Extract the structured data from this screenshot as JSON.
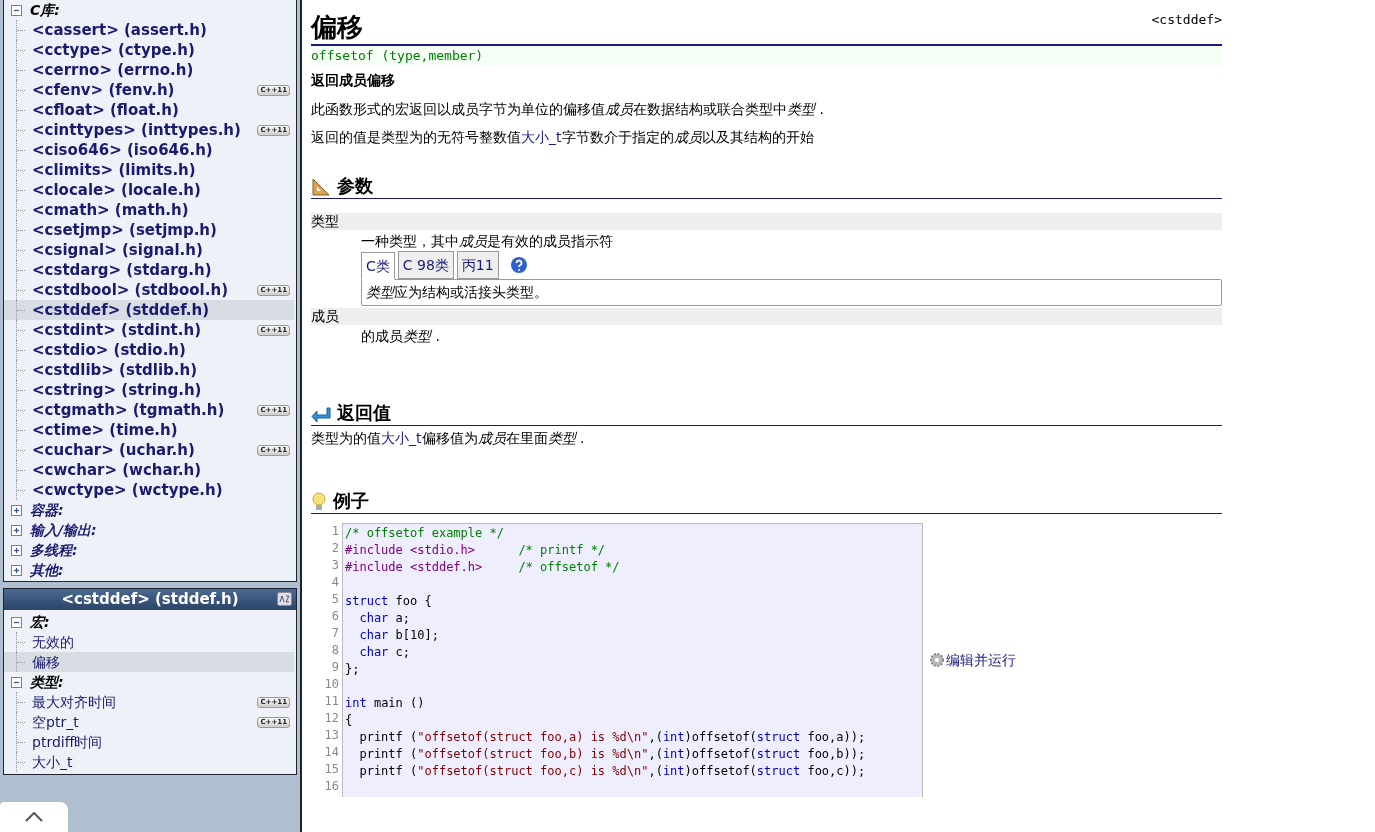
{
  "library_tree": [
    {
      "label": "C库:",
      "expanded": true,
      "children": [
        {
          "label": "<cassert> (assert.h)",
          "selected": false
        },
        {
          "label": "<cctype> (ctype.h)",
          "selected": false
        },
        {
          "label": "<cerrno> (errno.h)",
          "selected": false
        },
        {
          "label": "<cfenv> (fenv.h)",
          "selected": false,
          "badge": "C++11"
        },
        {
          "label": "<cfloat> (float.h)",
          "selected": false
        },
        {
          "label": "<cinttypes> (inttypes.h)",
          "selected": false,
          "badge": "C++11"
        },
        {
          "label": "<ciso646> (iso646.h)",
          "selected": false
        },
        {
          "label": "<climits> (limits.h)",
          "selected": false
        },
        {
          "label": "<clocale> (locale.h)",
          "selected": false
        },
        {
          "label": "<cmath> (math.h)",
          "selected": false
        },
        {
          "label": "<csetjmp> (setjmp.h)",
          "selected": false
        },
        {
          "label": "<csignal> (signal.h)",
          "selected": false
        },
        {
          "label": "<cstdarg> (stdarg.h)",
          "selected": false
        },
        {
          "label": "<cstdbool> (stdbool.h)",
          "selected": false,
          "badge": "C++11"
        },
        {
          "label": "<cstddef> (stddef.h)",
          "selected": true
        },
        {
          "label": "<cstdint> (stdint.h)",
          "selected": false,
          "badge": "C++11"
        },
        {
          "label": "<cstdio> (stdio.h)",
          "selected": false
        },
        {
          "label": "<cstdlib> (stdlib.h)",
          "selected": false
        },
        {
          "label": "<cstring> (string.h)",
          "selected": false
        },
        {
          "label": "<ctgmath> (tgmath.h)",
          "selected": false,
          "badge": "C++11"
        },
        {
          "label": "<ctime> (time.h)",
          "selected": false
        },
        {
          "label": "<cuchar> (uchar.h)",
          "selected": false,
          "badge": "C++11"
        },
        {
          "label": "<cwchar> (wchar.h)",
          "selected": false
        },
        {
          "label": "<cwctype> (wctype.h)",
          "selected": false
        }
      ]
    },
    {
      "label": "容器:",
      "expanded": false
    },
    {
      "label": "输入/输出:",
      "expanded": false
    },
    {
      "label": "多线程:",
      "expanded": false
    },
    {
      "label": "其他:",
      "expanded": false
    }
  ],
  "header_panel": {
    "title": "<cstddef> (stddef.h)",
    "tree": [
      {
        "label": "宏:",
        "expanded": true,
        "children": [
          {
            "label": "无效的",
            "selected": false
          },
          {
            "label": "偏移",
            "selected": true
          }
        ]
      },
      {
        "label": "类型:",
        "expanded": true,
        "children": [
          {
            "label": "最大对齐时间",
            "selected": false,
            "badge": "C++11"
          },
          {
            "label": "空ptr_t",
            "selected": false,
            "badge": "C++11"
          },
          {
            "label": "ptrdiff时间",
            "selected": false
          },
          {
            "label": "大小_t",
            "selected": false
          }
        ]
      }
    ]
  },
  "article": {
    "title": "偏移",
    "header": "<cstddef>",
    "prototype": "offsetof (type,member)",
    "summary": "返回成员偏移",
    "paragraphs": [
      [
        {
          "text": "此函数形式的宏返回以成员字节为单位的偏移值",
          "kind": "plain"
        },
        {
          "text": "成员",
          "kind": "term"
        },
        {
          "text": "在数据结构或联合类型中",
          "kind": "plain"
        },
        {
          "text": "类型",
          "kind": "term"
        },
        {
          "text": " .",
          "kind": "plain"
        }
      ],
      [
        {
          "text": "返回的值是类型为的无符号整数值",
          "kind": "plain"
        },
        {
          "text": "大小_t",
          "kind": "link"
        },
        {
          "text": "字节数介于指定的",
          "kind": "plain"
        },
        {
          "text": "成员",
          "kind": "term"
        },
        {
          "text": "以及其结构的开始",
          "kind": "plain"
        }
      ]
    ],
    "parameters_heading": "参数",
    "parameters": [
      {
        "name": "类型",
        "description": [
          {
            "text": "一种类型，其中",
            "kind": "plain"
          },
          {
            "text": "成员",
            "kind": "term"
          },
          {
            "text": "是有效的成员指示符",
            "kind": "plain"
          }
        ],
        "tabs": [
          {
            "label": "C类",
            "selected": true
          },
          {
            "label": "C 98类",
            "selected": false
          },
          {
            "label": "丙11",
            "selected": false
          }
        ],
        "tab_content": [
          {
            "text": "类型",
            "kind": "term"
          },
          {
            "text": "应为结构或活接头类型。",
            "kind": "plain"
          }
        ]
      },
      {
        "name": "成员",
        "description": [
          {
            "text": "的成员",
            "kind": "plain"
          },
          {
            "text": "类型",
            "kind": "term"
          },
          {
            "text": " .",
            "kind": "plain"
          }
        ]
      }
    ],
    "return_heading": "返回值",
    "return_text": [
      {
        "text": "类型为的值",
        "kind": "plain"
      },
      {
        "text": "大小_t",
        "kind": "link"
      },
      {
        "text": "偏移值为",
        "kind": "plain"
      },
      {
        "text": "成员",
        "kind": "term"
      },
      {
        "text": "在里面",
        "kind": "plain"
      },
      {
        "text": "类型",
        "kind": "term"
      },
      {
        "text": " .",
        "kind": "plain"
      }
    ],
    "example_heading": "例子",
    "code": [
      {
        "number": "1",
        "tokens": [
          {
            "kind": "comment",
            "text": "/* offsetof example */"
          }
        ]
      },
      {
        "number": "2",
        "tokens": [
          {
            "kind": "preproc",
            "text": "#include <stdio.h>"
          },
          {
            "kind": "comment",
            "text": "      /* printf */"
          }
        ]
      },
      {
        "number": "3",
        "tokens": [
          {
            "kind": "preproc",
            "text": "#include <stddef.h>"
          },
          {
            "kind": "comment",
            "text": "     /* offsetof */"
          }
        ]
      },
      {
        "number": "4"
      },
      {
        "number": "5",
        "tokens": [
          {
            "kind": "keyword",
            "text": "struct"
          },
          {
            "kind": "plain",
            "text": " foo {"
          }
        ]
      },
      {
        "number": "6",
        "tokens": [
          {
            "kind": "keyword",
            "text": "  char"
          },
          {
            "kind": "plain",
            "text": " a;"
          }
        ]
      },
      {
        "number": "7",
        "tokens": [
          {
            "kind": "keyword",
            "text": "  char"
          },
          {
            "kind": "plain",
            "text": " b[10];"
          }
        ]
      },
      {
        "number": "8",
        "tokens": [
          {
            "kind": "keyword",
            "text": "  char"
          },
          {
            "kind": "plain",
            "text": " c;"
          }
        ]
      },
      {
        "number": "9",
        "tokens": [
          {
            "kind": "plain",
            "text": "};"
          }
        ]
      },
      {
        "number": "10"
      },
      {
        "number": "11",
        "tokens": [
          {
            "kind": "keyword",
            "text": "int"
          },
          {
            "kind": "plain",
            "text": " main ()"
          }
        ]
      },
      {
        "number": "12",
        "tokens": [
          {
            "kind": "plain",
            "text": "{"
          }
        ]
      },
      {
        "number": "13",
        "tokens": [
          {
            "kind": "plain",
            "text": "  printf ("
          },
          {
            "kind": "string",
            "text": "\"offsetof(struct foo,a) is %d\\n\""
          },
          {
            "kind": "plain",
            "text": ",("
          },
          {
            "kind": "keyword",
            "text": "int"
          },
          {
            "kind": "plain",
            "text": ")offsetof("
          },
          {
            "kind": "keyword",
            "text": "struct"
          },
          {
            "kind": "plain",
            "text": " foo,a));"
          }
        ]
      },
      {
        "number": "14",
        "tokens": [
          {
            "kind": "plain",
            "text": "  printf ("
          },
          {
            "kind": "string",
            "text": "\"offsetof(struct foo,b) is %d\\n\""
          },
          {
            "kind": "plain",
            "text": ",("
          },
          {
            "kind": "keyword",
            "text": "int"
          },
          {
            "kind": "plain",
            "text": ")offsetof("
          },
          {
            "kind": "keyword",
            "text": "struct"
          },
          {
            "kind": "plain",
            "text": " foo,b));"
          }
        ]
      },
      {
        "number": "15",
        "tokens": [
          {
            "kind": "plain",
            "text": "  printf ("
          },
          {
            "kind": "string",
            "text": "\"offsetof(struct foo,c) is %d\\n\""
          },
          {
            "kind": "plain",
            "text": ",("
          },
          {
            "kind": "keyword",
            "text": "int"
          },
          {
            "kind": "plain",
            "text": ")offsetof("
          },
          {
            "kind": "keyword",
            "text": "struct"
          },
          {
            "kind": "plain",
            "text": " foo,c));"
          }
        ]
      },
      {
        "number": "16"
      }
    ],
    "run_link": "编辑并运行"
  }
}
